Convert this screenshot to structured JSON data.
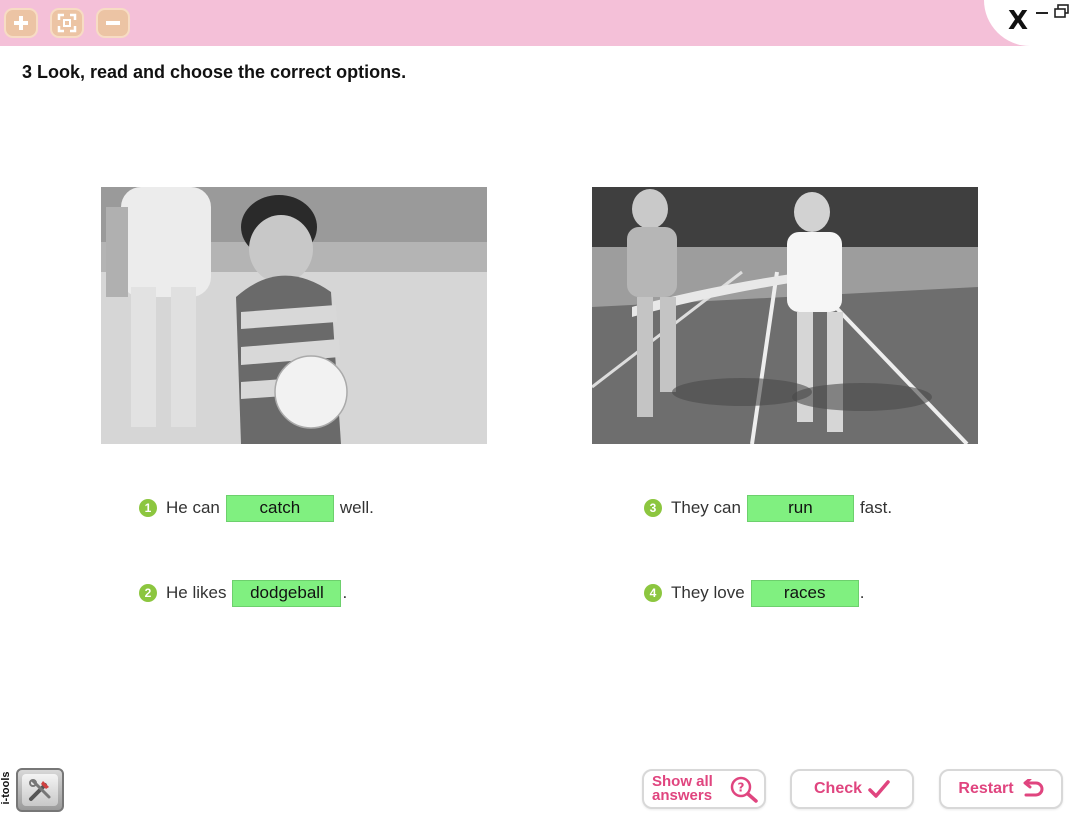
{
  "window": {
    "toolbar": [
      {
        "name": "zoom-in",
        "icon": "plus-icon"
      },
      {
        "name": "fit-screen",
        "icon": "fullscreen-icon"
      },
      {
        "name": "zoom-out",
        "icon": "minus-icon"
      }
    ],
    "close_label": "X",
    "colors": {
      "topbar": "#f4c0d8",
      "tool_button": "#ecc4a4",
      "accent": "#e0457f",
      "answer_bg": "#80f080",
      "number_badge": "#8cc63f"
    }
  },
  "exercise": {
    "heading": "3 Look, read and choose the correct options.",
    "photos": [
      {
        "description_icon": "boy-with-ball-photo"
      },
      {
        "description_icon": "girls-running-race-photo"
      }
    ],
    "sentences": [
      {
        "number": "1",
        "before": "He can",
        "answer": "catch",
        "after": "well."
      },
      {
        "number": "2",
        "before": "He likes",
        "answer": "dodgeball",
        "after": "."
      },
      {
        "number": "3",
        "before": "They can",
        "answer": "run",
        "after": "fast."
      },
      {
        "number": "4",
        "before": "They love",
        "answer": "races",
        "after": "."
      }
    ]
  },
  "footer": {
    "itools_label": "i-tools",
    "show_all_answers": "Show all answers",
    "check": "Check",
    "restart": "Restart"
  }
}
